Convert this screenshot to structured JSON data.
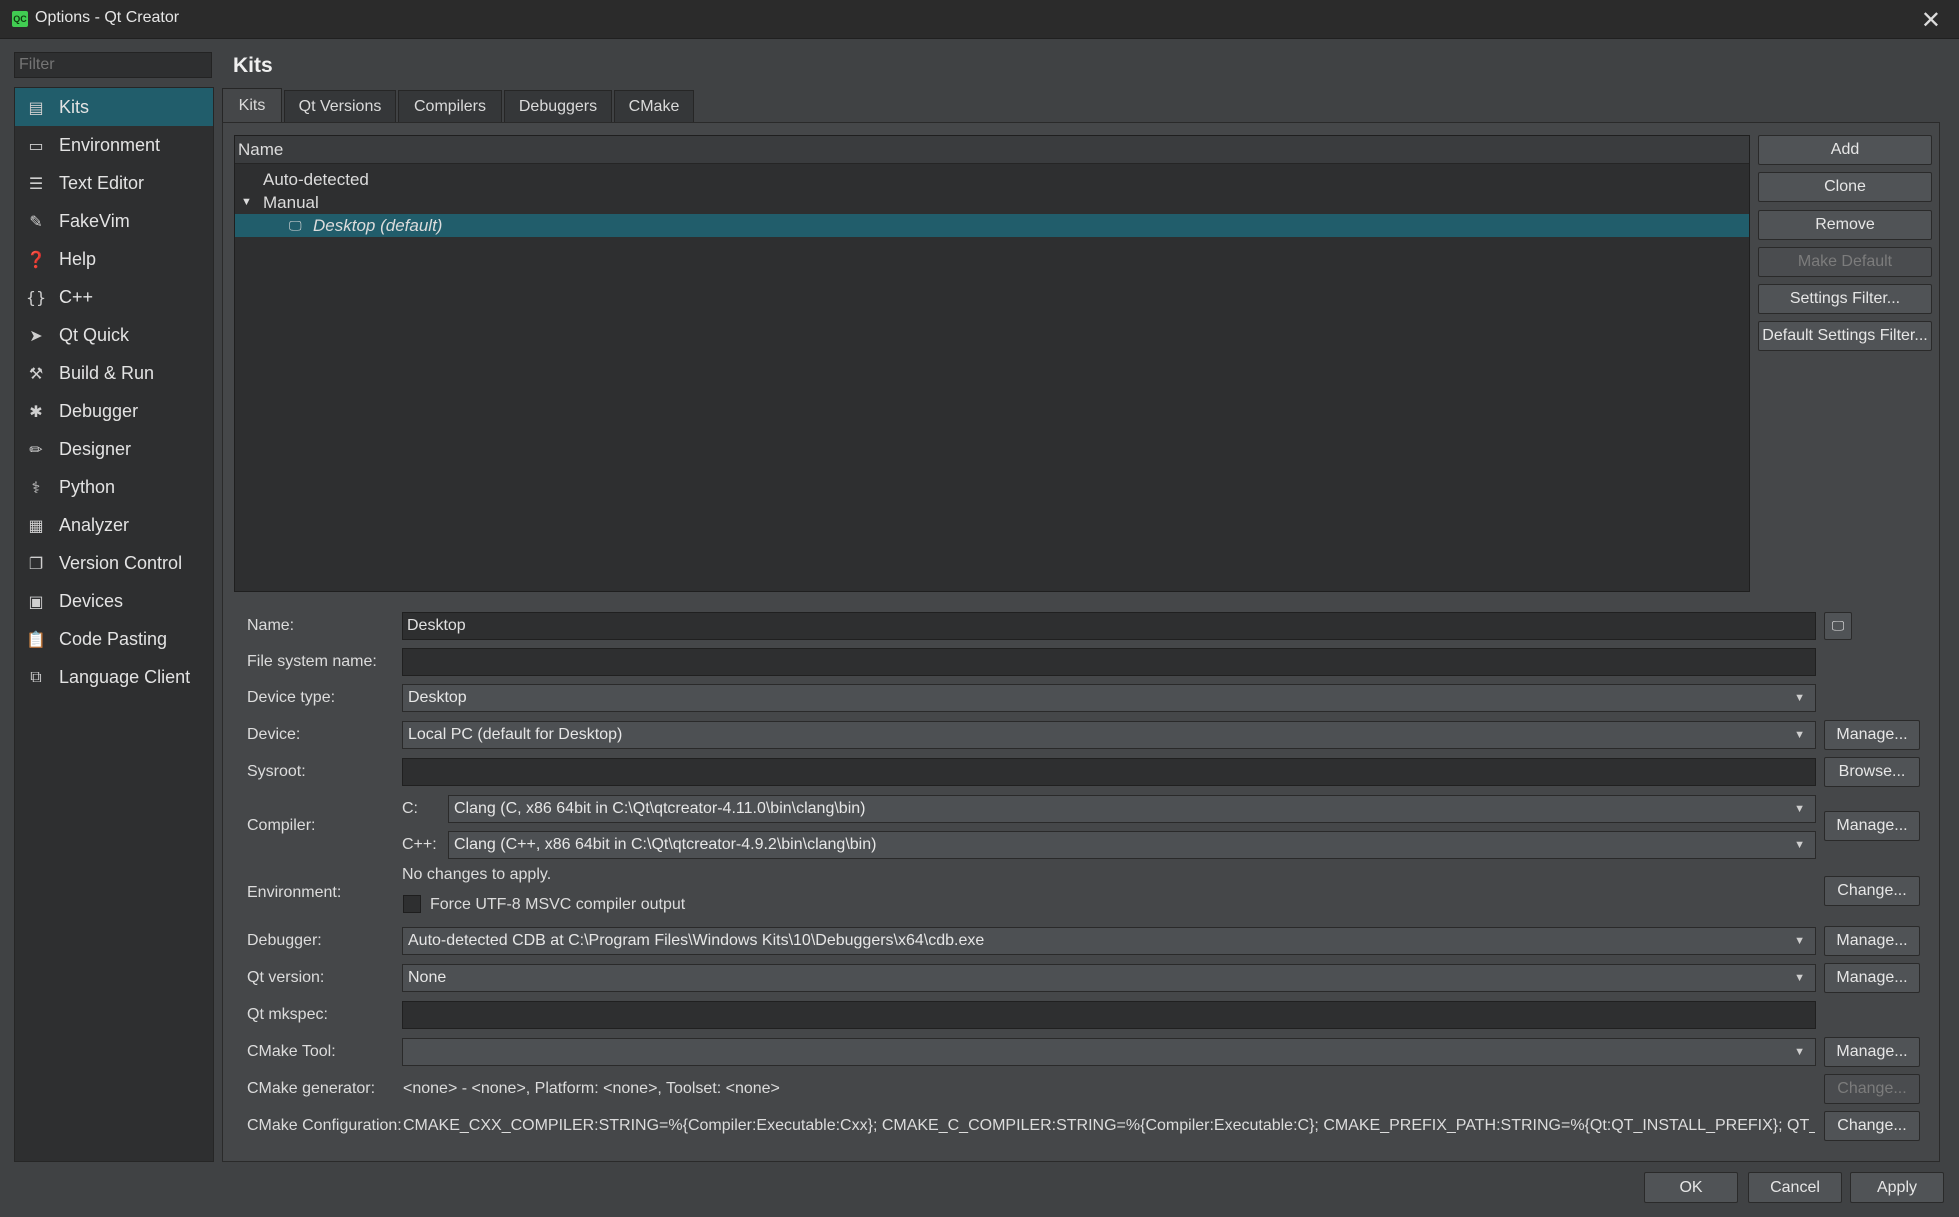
{
  "window": {
    "title": "Options - Qt Creator",
    "logo": "QC"
  },
  "sidebar": {
    "filter_placeholder": "Filter",
    "items": [
      {
        "label": "Kits",
        "icon": "kits-icon"
      },
      {
        "label": "Environment",
        "icon": "monitor-icon"
      },
      {
        "label": "Text Editor",
        "icon": "document-icon"
      },
      {
        "label": "FakeVim",
        "icon": "fakevim-icon"
      },
      {
        "label": "Help",
        "icon": "help-icon"
      },
      {
        "label": "C++",
        "icon": "braces-icon"
      },
      {
        "label": "Qt Quick",
        "icon": "paper-plane-icon"
      },
      {
        "label": "Build & Run",
        "icon": "hammer-icon"
      },
      {
        "label": "Debugger",
        "icon": "bug-icon"
      },
      {
        "label": "Designer",
        "icon": "pencil-icon"
      },
      {
        "label": "Python",
        "icon": "python-icon"
      },
      {
        "label": "Analyzer",
        "icon": "analyzer-icon"
      },
      {
        "label": "Version Control",
        "icon": "version-control-icon"
      },
      {
        "label": "Devices",
        "icon": "devices-icon"
      },
      {
        "label": "Code Pasting",
        "icon": "clipboard-icon"
      },
      {
        "label": "Language Client",
        "icon": "language-client-icon"
      }
    ]
  },
  "page": {
    "title": "Kits"
  },
  "tabs": [
    "Kits",
    "Qt Versions",
    "Compilers",
    "Debuggers",
    "CMake"
  ],
  "tree": {
    "header": "Name",
    "auto_detected": "Auto-detected",
    "manual": "Manual",
    "kit": "Desktop (default)"
  },
  "buttons": {
    "add": "Add",
    "clone": "Clone",
    "remove": "Remove",
    "make_default": "Make Default",
    "settings_filter": "Settings Filter...",
    "default_settings_filter": "Default Settings Filter..."
  },
  "form": {
    "name_label": "Name:",
    "name_value": "Desktop",
    "fs_label": "File system name:",
    "fs_value": "",
    "device_type_label": "Device type:",
    "device_type_value": "Desktop",
    "device_label": "Device:",
    "device_value": "Local PC (default for Desktop)",
    "sysroot_label": "Sysroot:",
    "sysroot_value": "",
    "compiler_label": "Compiler:",
    "c_label": "C:",
    "c_value": "Clang (C, x86 64bit in C:\\Qt\\qtcreator-4.11.0\\bin\\clang\\bin)",
    "cpp_label": "C++:",
    "cpp_value": "Clang (C++, x86 64bit in C:\\Qt\\qtcreator-4.9.2\\bin\\clang\\bin)",
    "env_label": "Environment:",
    "env_value": "No changes to apply.",
    "force_utf8": "Force UTF-8 MSVC compiler output",
    "debugger_label": "Debugger:",
    "debugger_value": "Auto-detected CDB at C:\\Program Files\\Windows Kits\\10\\Debuggers\\x64\\cdb.exe",
    "qt_version_label": "Qt version:",
    "qt_version_value": "None",
    "mkspec_label": "Qt mkspec:",
    "mkspec_value": "",
    "cmake_tool_label": "CMake Tool:",
    "cmake_tool_value": "",
    "cmake_gen_label": "CMake generator:",
    "cmake_gen_value": "<none> - <none>, Platform: <none>, Toolset: <none>",
    "cmake_conf_label": "CMake Configuration:",
    "cmake_conf_value": "CMAKE_CXX_COMPILER:STRING=%{Compiler:Executable:Cxx}; CMAKE_C_COMPILER:STRING=%{Compiler:Executable:C}; CMAKE_PREFIX_PATH:STRING=%{Qt:QT_INSTALL_PREFIX}; QT_QMAKE_EX...",
    "manage": "Manage...",
    "browse": "Browse...",
    "change": "Change..."
  },
  "footer": {
    "ok": "OK",
    "cancel": "Cancel",
    "apply": "Apply"
  }
}
